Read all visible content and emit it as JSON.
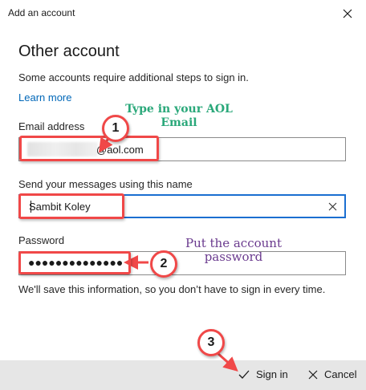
{
  "window": {
    "title": "Add an account",
    "close_icon": "close-icon"
  },
  "content": {
    "heading": "Other account",
    "subtitle": "Some accounts require additional steps to sign in.",
    "learn_more": "Learn more"
  },
  "fields": {
    "email": {
      "label": "Email address",
      "value": "@aol.com"
    },
    "name": {
      "label": "Send your messages using this name",
      "value": "Sambit Koley"
    },
    "password": {
      "label": "Password",
      "value": "●●●●●●●●●●●●●●"
    }
  },
  "note": "We'll save this information, so you don’t have to sign in every time.",
  "footer": {
    "sign_in_label": "Sign in",
    "cancel_label": "Cancel"
  },
  "annotations": {
    "badge_1": "1",
    "badge_2": "2",
    "badge_3": "3",
    "text_email": "Type in your AOL Email",
    "text_password": "Put the account password",
    "accent_red": "#f04848",
    "green": "#2aa87a",
    "purple": "#6a3a8e"
  },
  "colors": {
    "link": "#0067b8",
    "focus": "#1b6fd1",
    "footer_bg": "#e6e6e6"
  }
}
